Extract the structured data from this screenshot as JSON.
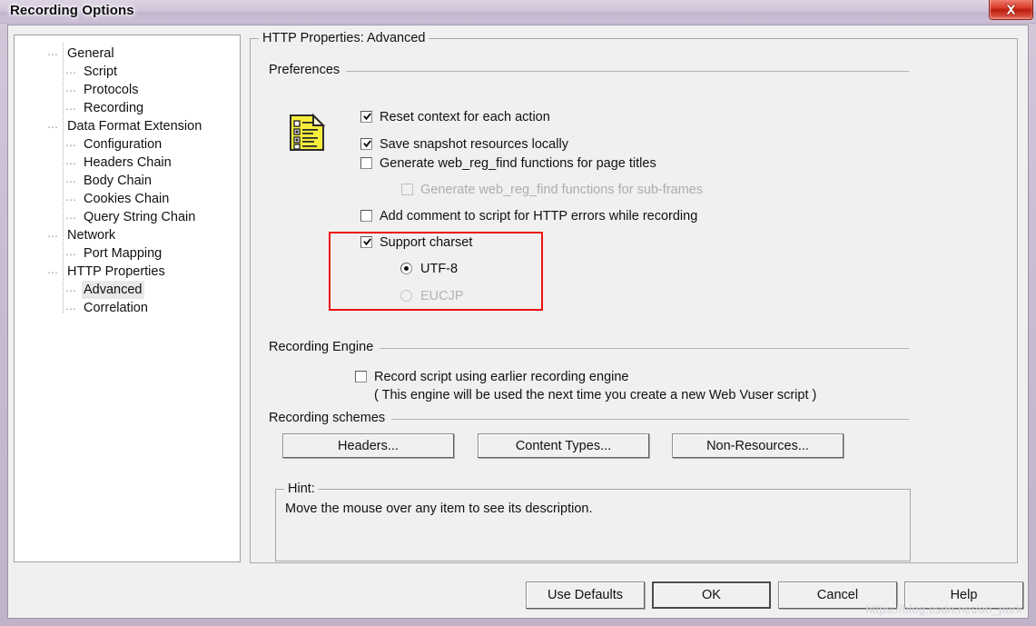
{
  "window": {
    "title": "Recording Options",
    "close_icon": "close-icon"
  },
  "tree": {
    "items": [
      {
        "label": "General",
        "indent": 0,
        "selected": false
      },
      {
        "label": "Script",
        "indent": 1,
        "selected": false
      },
      {
        "label": "Protocols",
        "indent": 1,
        "selected": false
      },
      {
        "label": "Recording",
        "indent": 1,
        "selected": false
      },
      {
        "label": "Data Format Extension",
        "indent": 0,
        "selected": false
      },
      {
        "label": "Configuration",
        "indent": 1,
        "selected": false
      },
      {
        "label": "Headers Chain",
        "indent": 1,
        "selected": false
      },
      {
        "label": "Body Chain",
        "indent": 1,
        "selected": false
      },
      {
        "label": "Cookies Chain",
        "indent": 1,
        "selected": false
      },
      {
        "label": "Query String Chain",
        "indent": 1,
        "selected": false
      },
      {
        "label": "Network",
        "indent": 0,
        "selected": false
      },
      {
        "label": "Port Mapping",
        "indent": 1,
        "selected": false
      },
      {
        "label": "HTTP Properties",
        "indent": 0,
        "selected": false
      },
      {
        "label": "Advanced",
        "indent": 1,
        "selected": true
      },
      {
        "label": "Correlation",
        "indent": 1,
        "selected": false
      }
    ]
  },
  "panel": {
    "title": "HTTP Properties: Advanced",
    "preferences": {
      "section_label": "Preferences",
      "icon": "form-document-icon",
      "checkboxes": [
        {
          "label": "Reset context for each action",
          "checked": true,
          "disabled": false
        },
        {
          "label": "Save snapshot resources locally",
          "checked": true,
          "disabled": false
        },
        {
          "label": "Generate web_reg_find functions for page titles",
          "checked": false,
          "disabled": false
        },
        {
          "label": "Generate web_reg_find functions for sub-frames",
          "checked": false,
          "disabled": true
        },
        {
          "label": "Add comment to script for HTTP errors while recording",
          "checked": false,
          "disabled": false
        },
        {
          "label": "Support charset",
          "checked": true,
          "disabled": false
        }
      ],
      "charset_options": [
        {
          "label": "UTF-8",
          "selected": true,
          "disabled": false
        },
        {
          "label": "EUCJP",
          "selected": false,
          "disabled": true
        }
      ],
      "highlight_color": "#ee1111"
    },
    "recording_engine": {
      "section_label": "Recording Engine",
      "checkbox": {
        "label": "Record script using earlier recording engine",
        "checked": false
      },
      "note": "( This engine will be used the next time you create a new Web Vuser script )"
    },
    "recording_schemes": {
      "section_label": "Recording schemes",
      "buttons": [
        {
          "label": "Headers..."
        },
        {
          "label": "Content Types..."
        },
        {
          "label": "Non-Resources..."
        }
      ]
    },
    "hint": {
      "title": "Hint:",
      "text": "Move the mouse over any item to see its description."
    }
  },
  "footer": {
    "buttons": [
      {
        "label": "Use Defaults",
        "default": false
      },
      {
        "label": "OK",
        "default": true
      },
      {
        "label": "Cancel",
        "default": false
      },
      {
        "label": "Help",
        "default": false
      }
    ],
    "watermark": "https://blog.csdn.net/oo_park"
  }
}
